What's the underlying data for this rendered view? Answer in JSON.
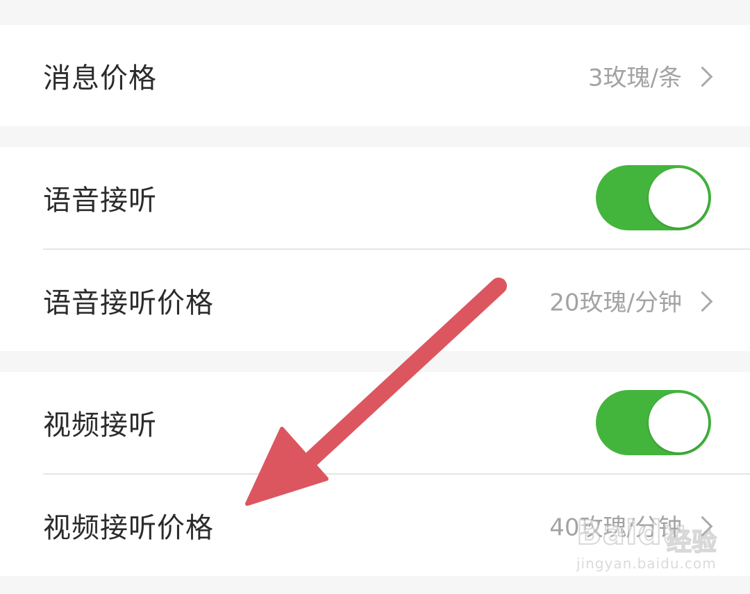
{
  "settings": {
    "message_price": {
      "label": "消息价格",
      "value": "3玫瑰/条"
    },
    "voice_answer": {
      "label": "语音接听",
      "enabled": true
    },
    "voice_price": {
      "label": "语音接听价格",
      "value": "20玫瑰/分钟"
    },
    "video_answer": {
      "label": "视频接听",
      "enabled": true
    },
    "video_price": {
      "label": "视频接听价格",
      "value": "40玫瑰/分钟"
    }
  },
  "colors": {
    "toggle_on": "#43b53d",
    "annotation_arrow": "#dc5660",
    "value_text": "#a3a3a3"
  },
  "icons": [
    "chevron-right-icon",
    "toggle-switch",
    "red-arrow-annotation"
  ],
  "watermark": {
    "logo": "Baidu",
    "logo_suffix": "经验",
    "url": "jingyan.baidu.com"
  }
}
